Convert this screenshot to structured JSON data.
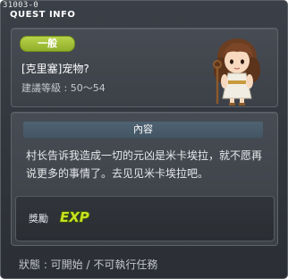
{
  "window": {
    "quest_id": "31003-0",
    "title": "QUEST INFO"
  },
  "quest": {
    "category_badge": "一般",
    "name": "[克里塞]宠物?",
    "level_text": "建議等級 : 50〜54"
  },
  "content": {
    "header": "內容",
    "text": "村长告诉我造成一切的元凶是米卡埃拉，就不愿再说更多的事情了。去见见米卡埃拉吧。"
  },
  "reward": {
    "label": "獎勵",
    "exp_text": "EXP"
  },
  "status": {
    "text": "狀態 : 可開始 / 不可執行任務"
  },
  "colors": {
    "badge_green": "#9ebd35",
    "panel_bg": "#41454c",
    "header_blue": "#4a5e6d",
    "exp_yellow": "#c8e020"
  },
  "icons": [
    "npc-portrait",
    "exp-icon"
  ]
}
